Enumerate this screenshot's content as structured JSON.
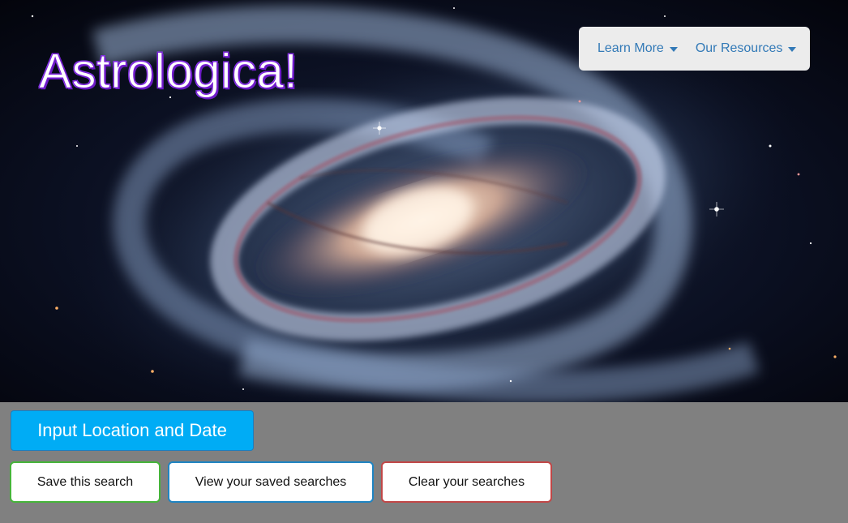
{
  "header": {
    "title": "Astrologica!",
    "hero_image": "spiral-galaxy-photo"
  },
  "nav": {
    "items": [
      {
        "label": "Learn More",
        "icon": "caret-down-icon"
      },
      {
        "label": "Our Resources",
        "icon": "caret-down-icon"
      }
    ]
  },
  "controls": {
    "input_button_label": "Input Location and Date",
    "save_label": "Save this search",
    "view_label": "View your saved searches",
    "clear_label": "Clear your searches"
  },
  "colors": {
    "page_background": "#808080",
    "primary_button": "#00acf5",
    "save_border": "#46b43a",
    "view_border": "#1f84c2",
    "clear_border": "#c14747",
    "nav_link": "#337ab7",
    "title_outline": "#7a1fd6"
  }
}
